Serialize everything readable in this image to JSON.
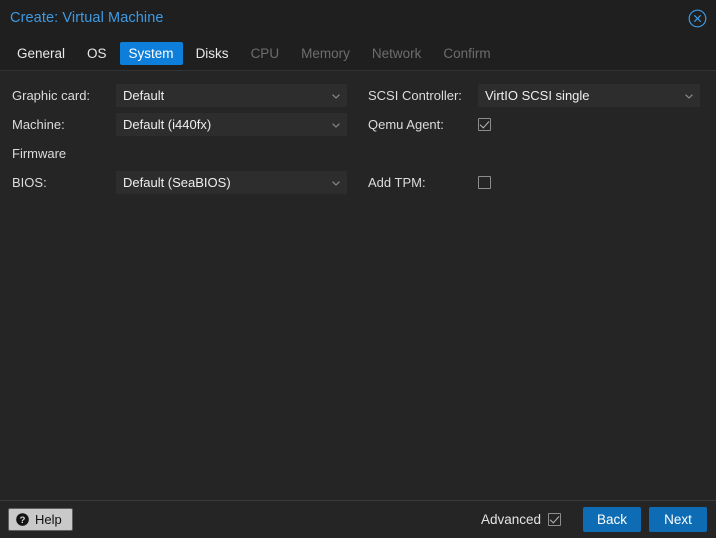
{
  "window": {
    "title": "Create: Virtual Machine",
    "close_icon": "close-circle-icon"
  },
  "tabs": [
    {
      "label": "General",
      "state": "enabled"
    },
    {
      "label": "OS",
      "state": "enabled"
    },
    {
      "label": "System",
      "state": "active"
    },
    {
      "label": "Disks",
      "state": "enabled"
    },
    {
      "label": "CPU",
      "state": "disabled"
    },
    {
      "label": "Memory",
      "state": "disabled"
    },
    {
      "label": "Network",
      "state": "disabled"
    },
    {
      "label": "Confirm",
      "state": "disabled"
    }
  ],
  "form": {
    "left": {
      "graphic_card": {
        "label": "Graphic card:",
        "value": "Default"
      },
      "machine": {
        "label": "Machine:",
        "value": "Default (i440fx)"
      },
      "firmware_section": {
        "label": "Firmware"
      },
      "bios": {
        "label": "BIOS:",
        "value": "Default (SeaBIOS)"
      }
    },
    "right": {
      "scsi_controller": {
        "label": "SCSI Controller:",
        "value": "VirtIO SCSI single"
      },
      "qemu_agent": {
        "label": "Qemu Agent:",
        "checked": true
      },
      "add_tpm": {
        "label": "Add TPM:",
        "checked": false
      }
    }
  },
  "footer": {
    "help_label": "Help",
    "help_icon": "question-mark-circle-icon",
    "advanced_label": "Advanced",
    "advanced_checked": true,
    "back_label": "Back",
    "next_label": "Next"
  },
  "colors": {
    "accent_blue": "#0d7fdb",
    "title_blue": "#3d9ae3",
    "button_blue": "#0e6cb4",
    "window_bg": "#252525",
    "header_bg": "#1f1f1f",
    "field_bg": "#2d2d2d"
  }
}
